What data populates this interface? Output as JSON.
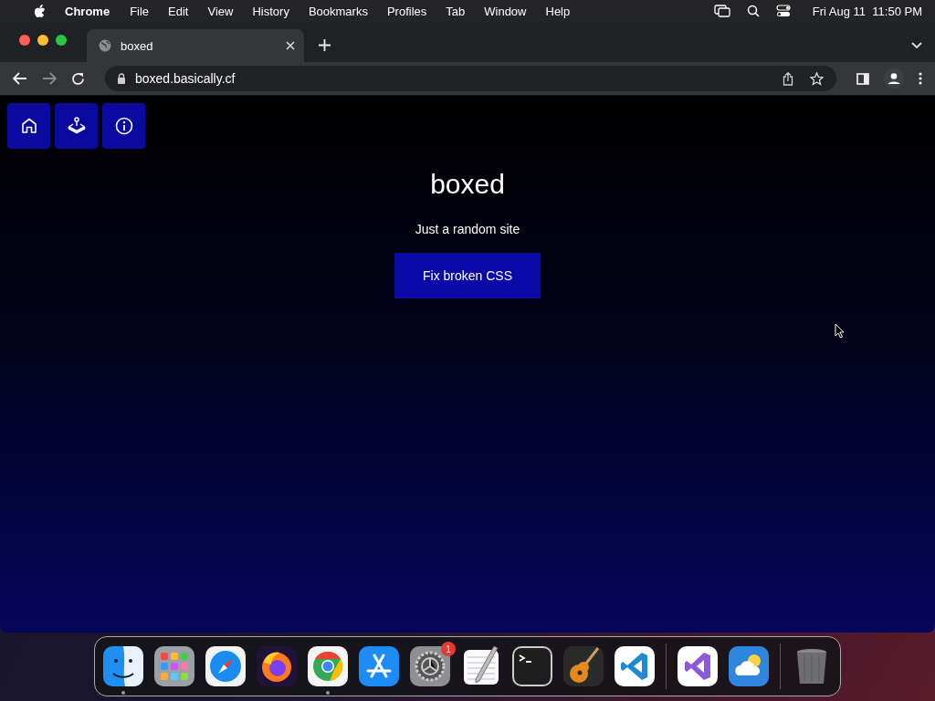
{
  "menu_bar": {
    "app_name": "Chrome",
    "items": [
      "File",
      "Edit",
      "View",
      "History",
      "Bookmarks",
      "Profiles",
      "Tab",
      "Window",
      "Help"
    ],
    "clock": "Fri Aug 11  11:50 PM"
  },
  "browser": {
    "tabs": [
      {
        "title": "boxed",
        "selected": true
      }
    ],
    "address": "boxed.basically.cf"
  },
  "page": {
    "title": "boxed",
    "subtitle": "Just a random site",
    "button": "Fix broken CSS"
  },
  "dock": {
    "apps": [
      {
        "kind": "finder",
        "running": true
      },
      {
        "kind": "launchpad",
        "running": false
      },
      {
        "kind": "safari",
        "running": false
      },
      {
        "kind": "firefox",
        "running": false
      },
      {
        "kind": "chrome",
        "running": true
      },
      {
        "kind": "appstore",
        "running": false
      },
      {
        "kind": "settings",
        "running": false,
        "badge": "1"
      },
      {
        "kind": "textedit",
        "running": false
      },
      {
        "kind": "terminal",
        "running": false
      },
      {
        "kind": "garageband",
        "running": false
      },
      {
        "kind": "vscode",
        "running": false
      },
      {
        "kind": "separator"
      },
      {
        "kind": "visualstudio",
        "running": false
      },
      {
        "kind": "weather",
        "running": false
      },
      {
        "kind": "separator"
      },
      {
        "kind": "trash",
        "running": false
      }
    ]
  }
}
